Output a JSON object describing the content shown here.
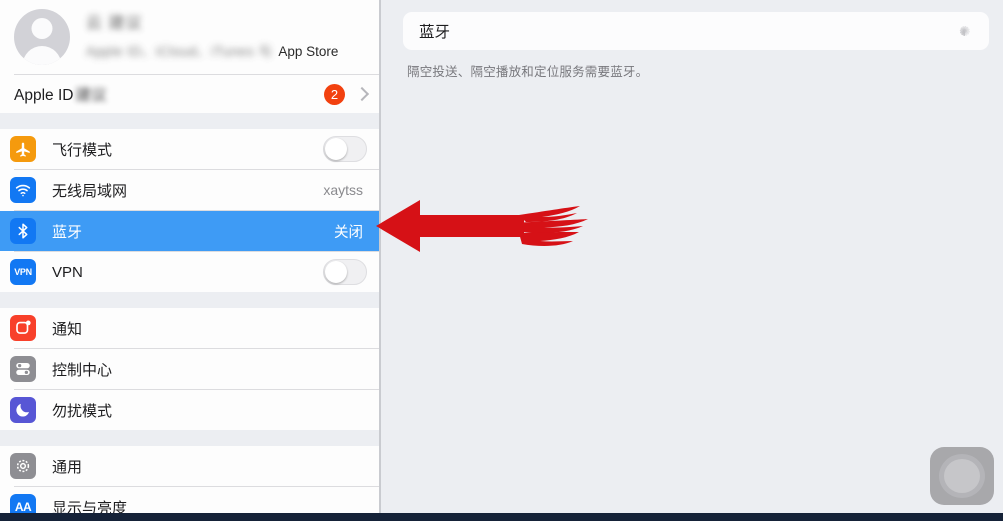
{
  "app": {
    "platform": "ios-settings",
    "accent_blue": "#3e9bf5",
    "badge_red": "#f2410f",
    "arrow_red": "#d61116"
  },
  "sidebar": {
    "profile": {
      "name_blurred": "云  建议",
      "subtitle_blurred": "Apple ID、iCloud、iTunes 与",
      "subtitle_clear": "App Store",
      "avatar_icon": "person-avatar"
    },
    "apple_id_row": {
      "label": "Apple ID",
      "label_blurred": "建议",
      "badge": "2",
      "chevron_icon": "chevron-right-icon"
    },
    "groups": [
      {
        "items": [
          {
            "label": "飞行模式",
            "icon": "airplane-icon",
            "control": "toggle",
            "toggle_on": false,
            "value": ""
          },
          {
            "label": "无线局域网",
            "icon": "wifi-icon",
            "control": "value",
            "toggle_on": false,
            "value": "xaytss"
          },
          {
            "label": "蓝牙",
            "icon": "bluetooth-icon",
            "control": "value",
            "toggle_on": false,
            "value": "关闭",
            "selected": true
          },
          {
            "label": "VPN",
            "icon": "vpn-icon",
            "control": "toggle",
            "toggle_on": false,
            "value": ""
          }
        ]
      },
      {
        "items": [
          {
            "label": "通知",
            "icon": "notifications-icon",
            "control": "none",
            "value": ""
          },
          {
            "label": "控制中心",
            "icon": "control-center-icon",
            "control": "none",
            "value": ""
          },
          {
            "label": "勿扰模式",
            "icon": "do-not-disturb-icon",
            "control": "none",
            "value": ""
          }
        ]
      },
      {
        "items": [
          {
            "label": "通用",
            "icon": "gear-icon",
            "control": "none",
            "value": ""
          },
          {
            "label": "显示与亮度",
            "icon": "display-brightness-icon",
            "control": "none",
            "value": ""
          }
        ]
      }
    ]
  },
  "detail": {
    "title": "蓝牙",
    "spinner_icon": "activity-spinner-icon",
    "description": "隔空投送、隔空播放和定位服务需要蓝牙。"
  },
  "annotation": {
    "arrow_icon": "flame-arrow-left-icon",
    "points_at": "蓝牙"
  },
  "overlay": {
    "assistive_touch_icon": "assistive-touch-button"
  }
}
